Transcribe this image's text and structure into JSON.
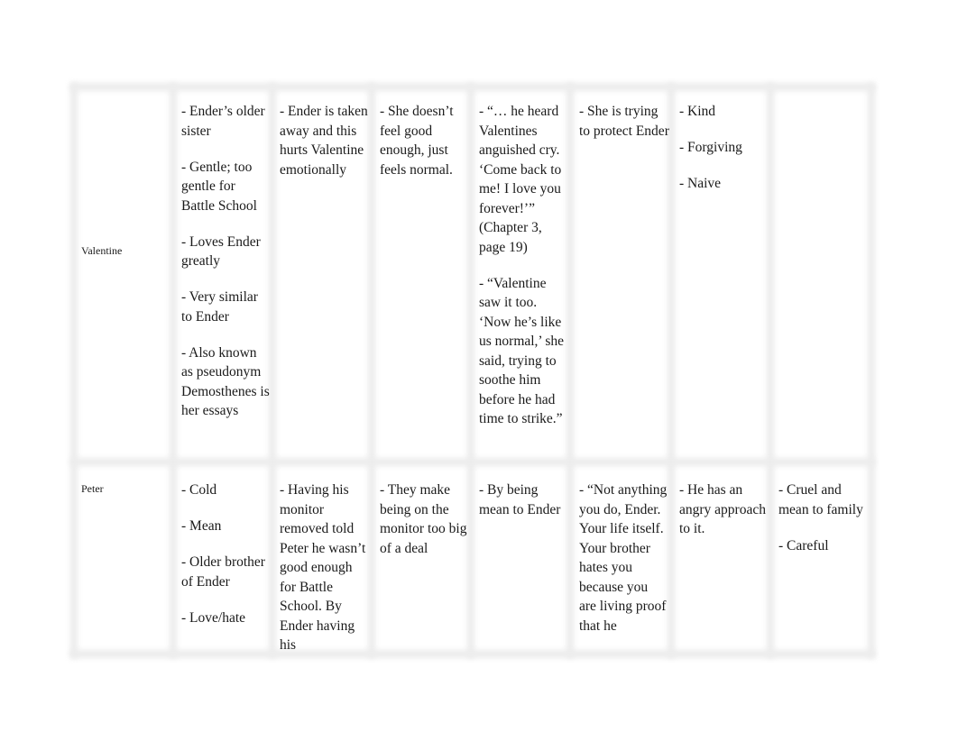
{
  "table": {
    "rows": [
      {
        "label": "Valentine",
        "cells": [
          [
            "- Ender’s older sister",
            "- Gentle; too gentle for Battle School",
            "- Loves Ender greatly",
            "- Very similar to Ender",
            "- Also known as pseudonym Demosthenes is her essays"
          ],
          [
            "- Ender is taken away and this hurts Valentine emotionally"
          ],
          [
            "- She doesn’t feel good enough, just feels normal."
          ],
          [
            "- “… he heard Valentines anguished cry. ‘Come back to me! I love you forever!’” (Chapter 3, page 19)",
            "- “Valentine saw it too. ‘Now he’s like us normal,’ she said, trying to soothe him before he had time to strike.”"
          ],
          [
            "- She is trying to protect Ender"
          ],
          [
            "- Kind",
            "- Forgiving",
            "- Naive"
          ],
          []
        ]
      },
      {
        "label": "Peter",
        "cells": [
          [
            "- Cold",
            "- Mean",
            "- Older brother of Ender",
            "- Love/hate"
          ],
          [
            "- Having his monitor removed told Peter he wasn’t good enough for Battle School. By Ender having his"
          ],
          [
            "- They make being on the monitor too big of a deal"
          ],
          [
            "- By being mean to Ender"
          ],
          [
            "- “Not anything you do, Ender. Your life itself. Your brother hates you because you are living proof that he"
          ],
          [
            "- He has an angry approach to it."
          ],
          [
            "- Cruel and mean to family",
            "- Careful"
          ]
        ]
      }
    ]
  }
}
